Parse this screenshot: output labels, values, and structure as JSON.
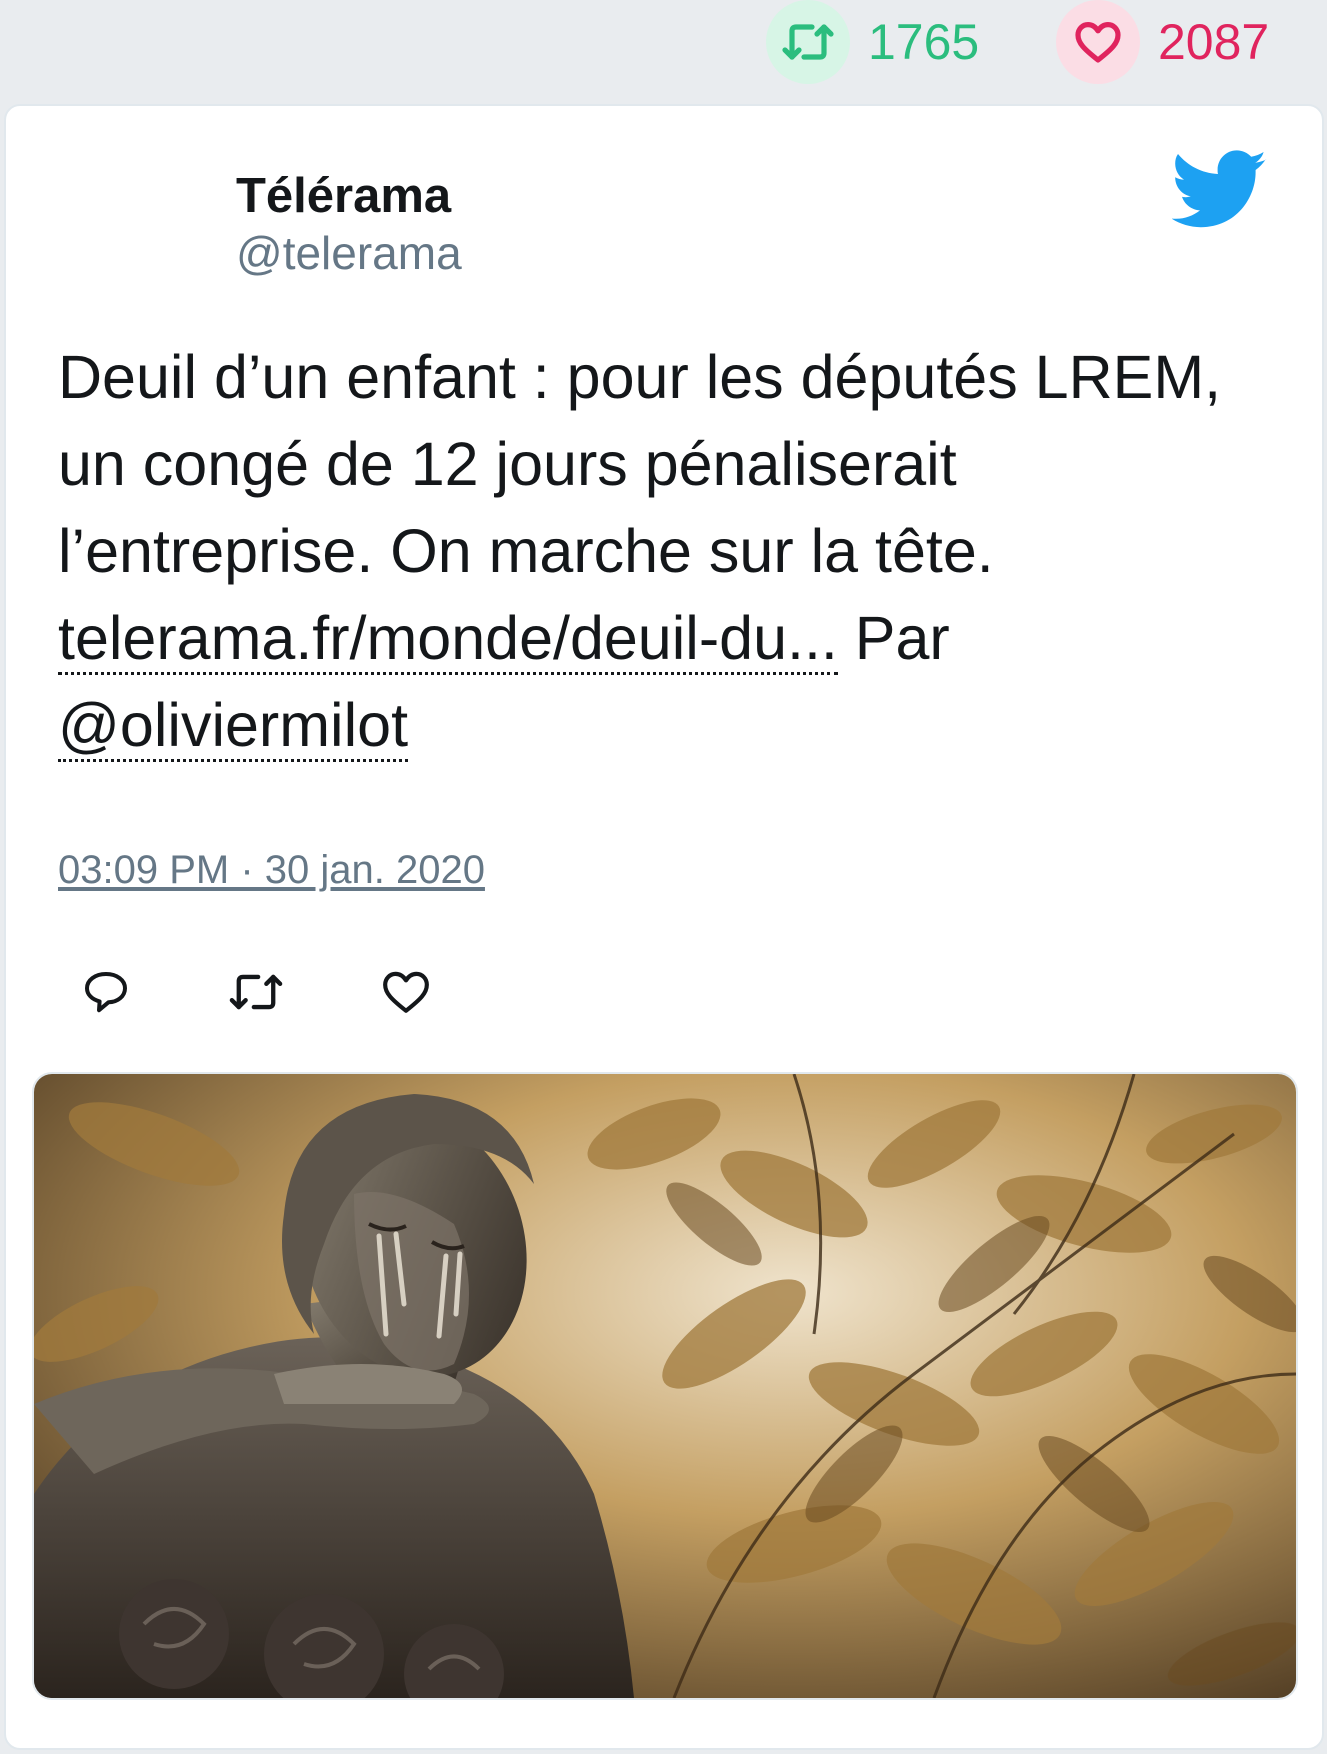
{
  "stats": {
    "retweets": "1765",
    "likes": "2087"
  },
  "author": {
    "name": "Télérama",
    "handle": "@telerama"
  },
  "tweet": {
    "text_1": "Deuil d’un enfant : pour les députés LREM, un congé de 12 jours pénaliserait l’entreprise. On marche sur la tête.",
    "link": "telerama.fr/monde/deuil-du...",
    "text_2": "Par",
    "mention": "@oliviermilot",
    "timestamp": "03:09 PM · 30 jan. 2020"
  },
  "icons": {
    "retweet": "retweet-icon",
    "like": "heart-icon",
    "reply": "reply-icon",
    "brand": "twitter-bird-icon"
  },
  "colors": {
    "retweet": "#2bbd7e",
    "like": "#e0245e",
    "twitter_blue": "#1da1f2",
    "muted": "#657786"
  }
}
